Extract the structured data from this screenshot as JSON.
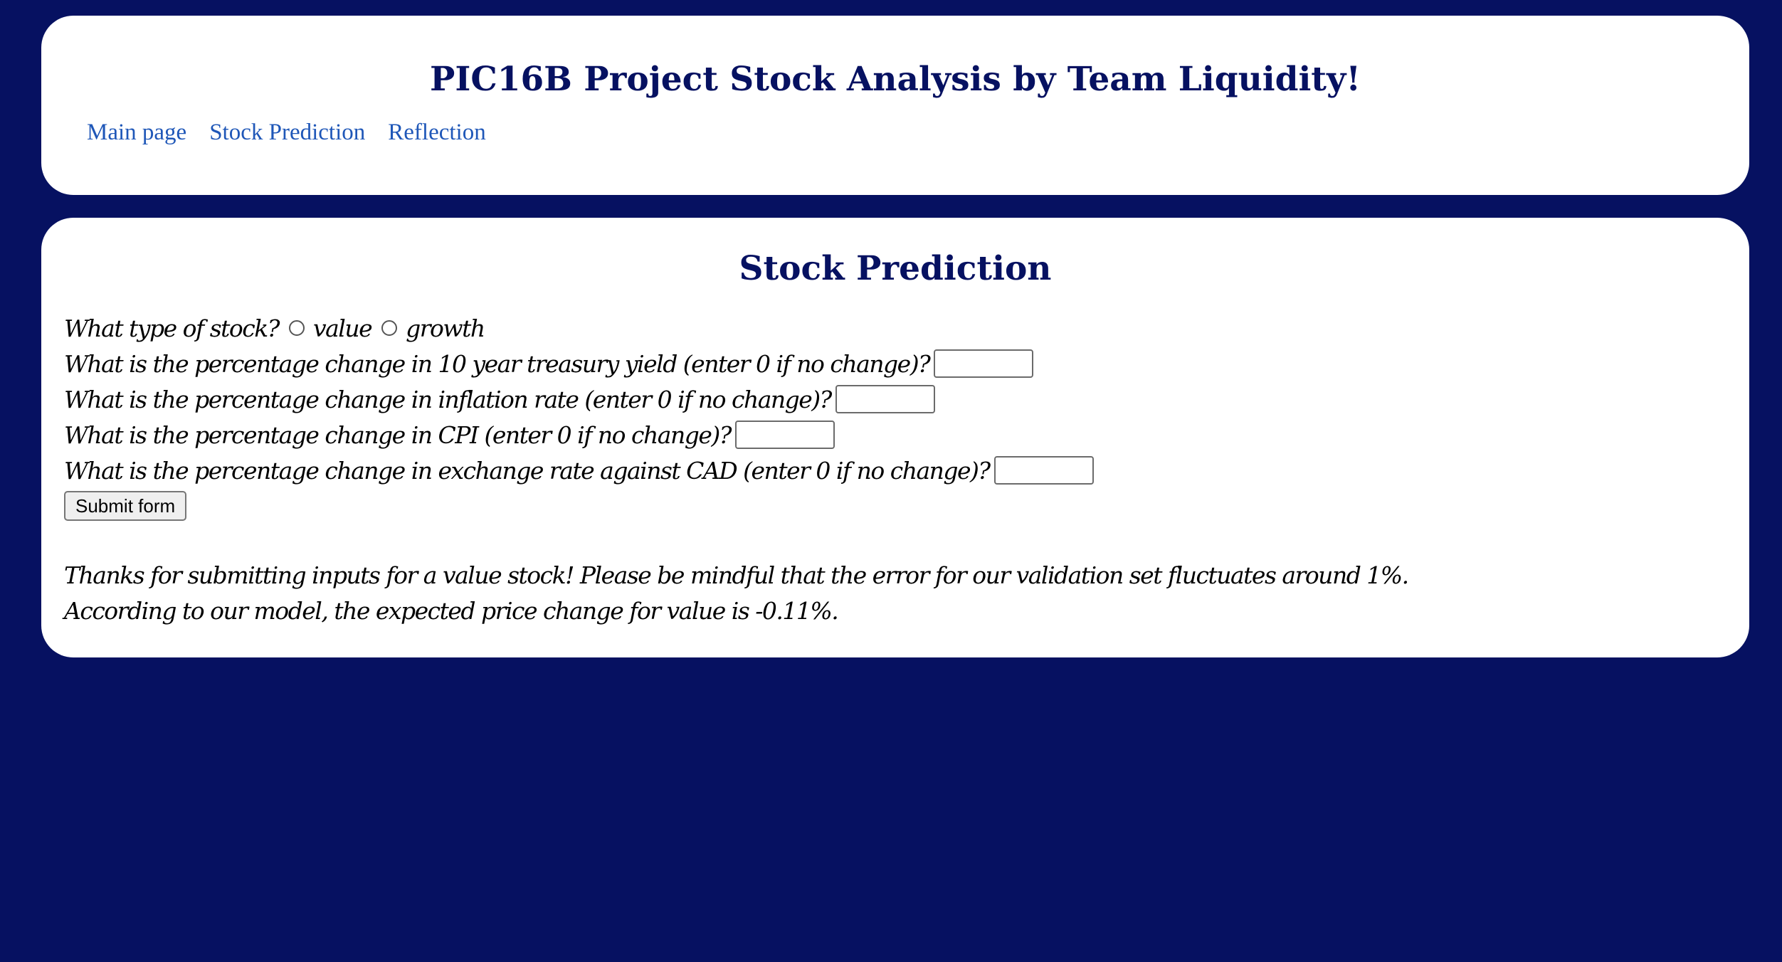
{
  "header": {
    "title": "PIC16B Project Stock Analysis by Team Liquidity!",
    "nav": [
      {
        "label": "Main page"
      },
      {
        "label": "Stock Prediction"
      },
      {
        "label": "Reflection"
      }
    ]
  },
  "main": {
    "title": "Stock Prediction",
    "form": {
      "stock_type_question": "What type of stock?",
      "stock_type_options": [
        "value",
        "growth"
      ],
      "questions": [
        {
          "label": "What is the percentage change in 10 year treasury yield (enter 0 if no change)?",
          "value": ""
        },
        {
          "label": "What is the percentage change in inflation rate (enter 0 if no change)?",
          "value": ""
        },
        {
          "label": "What is the percentage change in CPI (enter 0 if no change)?",
          "value": ""
        },
        {
          "label": "What is the percentage change in exchange rate against CAD (enter 0 if no change)?",
          "value": ""
        }
      ],
      "submit_label": "Submit form"
    },
    "result": {
      "line1": "Thanks for submitting inputs for a value stock! Please be mindful that the error for our validation set fluctuates around 1%.",
      "line2": "According to our model, the expected price change for value is -0.11%."
    }
  },
  "colors": {
    "background": "#061161",
    "card": "#ffffff",
    "title": "#061161",
    "link": "#1f57b8"
  }
}
